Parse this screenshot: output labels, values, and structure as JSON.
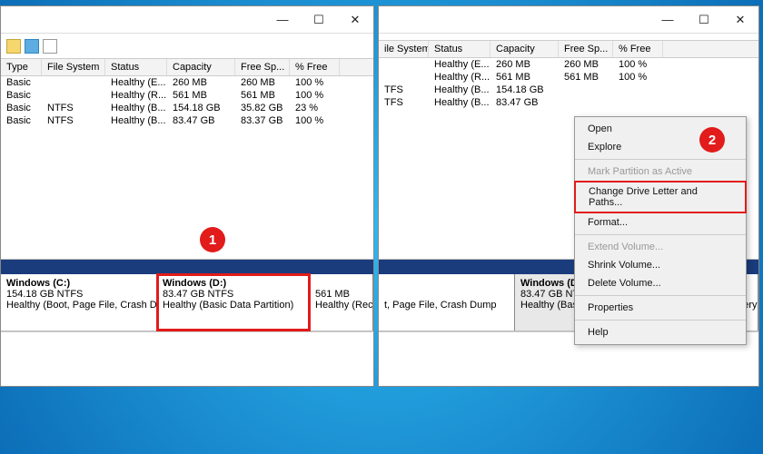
{
  "columns": {
    "type": "Type",
    "fs": "File System",
    "status": "Status",
    "capacity": "Capacity",
    "free": "Free Sp...",
    "pfree": "% Free"
  },
  "rows": [
    {
      "type": "Basic",
      "fs": "",
      "status": "Healthy (E...",
      "cap": "260 MB",
      "free": "260 MB",
      "pfree": "100 %"
    },
    {
      "type": "Basic",
      "fs": "",
      "status": "Healthy (R...",
      "cap": "561 MB",
      "free": "561 MB",
      "pfree": "100 %"
    },
    {
      "type": "Basic",
      "fs": "NTFS",
      "status": "Healthy (B...",
      "cap": "154.18 GB",
      "free": "35.82 GB",
      "pfree": "23 %"
    },
    {
      "type": "Basic",
      "fs": "NTFS",
      "status": "Healthy (B...",
      "cap": "83.47 GB",
      "free": "83.37 GB",
      "pfree": "100 %"
    }
  ],
  "volumes": {
    "c": {
      "name": "Windows  (C:)",
      "size": "154.18 GB NTFS",
      "state": "Healthy (Boot, Page File, Crash Dump"
    },
    "d": {
      "name": "Windows  (D:)",
      "size": "83.47 GB NTFS",
      "state": "Healthy (Basic Data Partition)"
    },
    "rec": {
      "name": "",
      "size": "561 MB",
      "state": "Healthy (Recovery"
    }
  },
  "rightRowsClipped": {
    "fsCol": "ile System",
    "row1fs": "TFS",
    "row2status": "t, Page File, Crash Dump"
  },
  "context": {
    "open": "Open",
    "explore": "Explore",
    "markActive": "Mark Partition as Active",
    "changeLetter": "Change Drive Letter and Paths...",
    "format": "Format...",
    "extend": "Extend Volume...",
    "shrink": "Shrink Volume...",
    "delvol": "Delete Volume...",
    "properties": "Properties",
    "help": "Help"
  },
  "badges": {
    "one": "1",
    "two": "2"
  }
}
